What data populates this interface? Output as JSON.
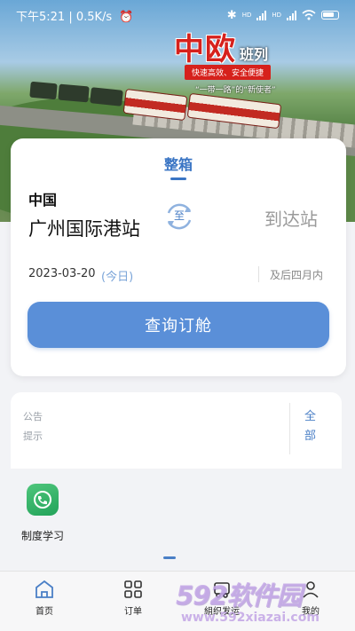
{
  "status_bar": {
    "time_speed": "下午5:21 | 0.5K/s",
    "network_1": "HD",
    "network_2": "HD"
  },
  "banner": {
    "title": "中欧",
    "title_suffix": "班列",
    "slogan": "快速高效、安全便捷",
    "slogan2": "“一带一路”的“新使者”"
  },
  "booking": {
    "tab": "整箱",
    "from_country": "中国",
    "from_station": "广州国际港站",
    "swap_label": "至",
    "to_placeholder": "到达站",
    "date": "2023-03-20",
    "date_hint": "(今日)",
    "range": "及后四月内",
    "query_button": "查询订舱"
  },
  "notice": {
    "line1": "公告",
    "line2": "提示",
    "all_label": "全部"
  },
  "functions": [
    {
      "label": "制度学习",
      "icon": "phone-icon",
      "color": "#2fb464"
    }
  ],
  "nav": [
    {
      "label": "首页",
      "icon": "home-icon"
    },
    {
      "label": "订单",
      "icon": "grid-icon"
    },
    {
      "label": "組织发运",
      "icon": "truck-icon"
    },
    {
      "label": "我的",
      "icon": "user-icon"
    }
  ],
  "watermark": {
    "main": "592软件园",
    "url": "www.592xiazai.com"
  },
  "colors": {
    "accent": "#4a7fc6",
    "button": "#5a8fd8",
    "brand_red": "#d6211c"
  }
}
